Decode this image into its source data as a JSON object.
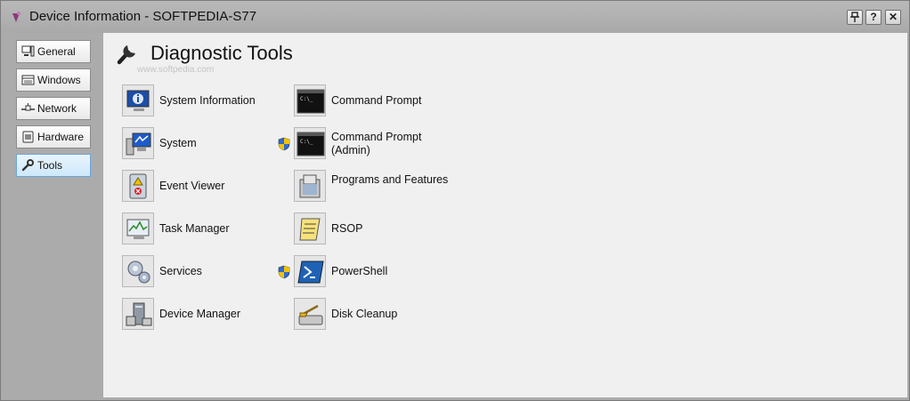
{
  "window": {
    "title": "Device Information - SOFTPEDIA-S77",
    "buttons": {
      "pin": "⎐",
      "help": "?",
      "close": "✕"
    }
  },
  "sidebar": {
    "items": [
      {
        "label": "General",
        "icon": "computer-icon"
      },
      {
        "label": "Windows",
        "icon": "window-icon"
      },
      {
        "label": "Network",
        "icon": "network-icon"
      },
      {
        "label": "Hardware",
        "icon": "chip-icon"
      },
      {
        "label": "Tools",
        "icon": "wrench-icon",
        "selected": true
      }
    ]
  },
  "main": {
    "heading": "Diagnostic Tools",
    "watermark": "www.softpedia.com",
    "tools_left": [
      {
        "label": "System Information",
        "icon": "system-information-icon"
      },
      {
        "label": "System",
        "icon": "system-icon"
      },
      {
        "label": "Event Viewer",
        "icon": "event-viewer-icon"
      },
      {
        "label": "Task Manager",
        "icon": "task-manager-icon"
      },
      {
        "label": "Services",
        "icon": "services-icon"
      },
      {
        "label": "Device Manager",
        "icon": "device-manager-icon"
      }
    ],
    "tools_right": [
      {
        "label": "Command Prompt",
        "icon": "command-prompt-icon"
      },
      {
        "label": "Command Prompt (Admin)",
        "icon": "command-prompt-icon",
        "uac_shield": true
      },
      {
        "label": "Programs and Features",
        "icon": "programs-features-icon"
      },
      {
        "label": "RSOP",
        "icon": "rsop-icon"
      },
      {
        "label": "PowerShell",
        "icon": "powershell-icon",
        "uac_shield": true
      },
      {
        "label": "Disk Cleanup",
        "icon": "disk-cleanup-icon"
      }
    ]
  },
  "colors": {
    "sidebar_bg": "#ababab",
    "content_bg": "#f0f0f0",
    "selected_nav": "#cde8fb"
  }
}
